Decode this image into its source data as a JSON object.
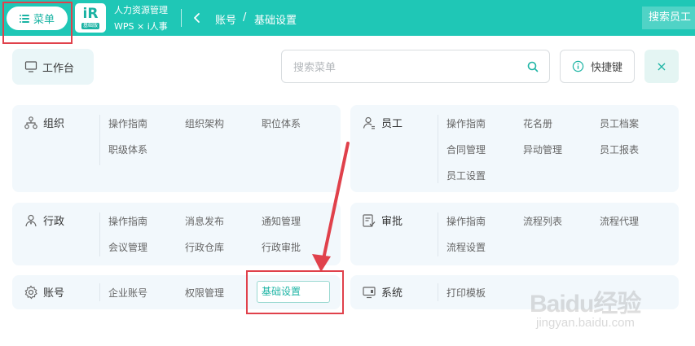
{
  "topbar": {
    "menu_label": "菜单",
    "logo_mark": "iR",
    "logo_sub": "基础版",
    "app_name": "人力资源管理",
    "app_sub": "WPS × i人事",
    "breadcrumb_parent": "账号",
    "breadcrumb_sep": "/",
    "breadcrumb_current": "基础设置",
    "search_label": "搜索员工",
    "accent": "#1fc7b6"
  },
  "toolbar": {
    "workbench_label": "工作台",
    "search_placeholder": "搜索菜单",
    "shortcut_label": "快捷键",
    "close_label": "×"
  },
  "sections": {
    "org": {
      "title": "组织",
      "items": [
        "操作指南",
        "组织架构",
        "职位体系",
        "职级体系"
      ]
    },
    "staff": {
      "title": "员工",
      "items": [
        "操作指南",
        "花名册",
        "员工档案",
        "合同管理",
        "异动管理",
        "员工报表",
        "员工设置"
      ]
    },
    "admin": {
      "title": "行政",
      "items": [
        "操作指南",
        "消息发布",
        "通知管理",
        "会议管理",
        "行政仓库",
        "行政审批"
      ]
    },
    "approval": {
      "title": "审批",
      "items": [
        "操作指南",
        "流程列表",
        "流程代理",
        "流程设置"
      ]
    },
    "account": {
      "title": "账号",
      "items": [
        "企业账号",
        "权限管理",
        "基础设置"
      ]
    },
    "system": {
      "title": "系统",
      "items": [
        "打印模板"
      ]
    }
  },
  "annotation_color": "#e0414b",
  "watermark": {
    "main": "Baidu经验",
    "sub": "jingyan.baidu.com"
  }
}
